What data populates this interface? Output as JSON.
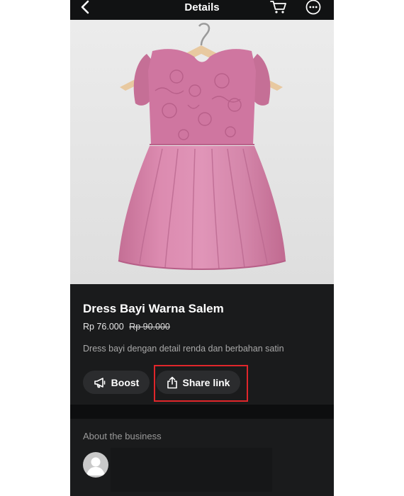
{
  "header": {
    "title": "Details"
  },
  "product": {
    "title": "Dress Bayi Warna Salem",
    "price": "Rp 76.000",
    "original_price": "Rp 90.000",
    "description": "Dress bayi dengan detail renda dan berbahan satin",
    "image_icon": "product-photo-pink-dress"
  },
  "actions": {
    "boost_label": "Boost",
    "share_label": "Share link"
  },
  "about": {
    "title": "About the business"
  },
  "colors": {
    "background": "#141516",
    "highlight": "#e0262b",
    "pill": "#2b2c2e"
  }
}
